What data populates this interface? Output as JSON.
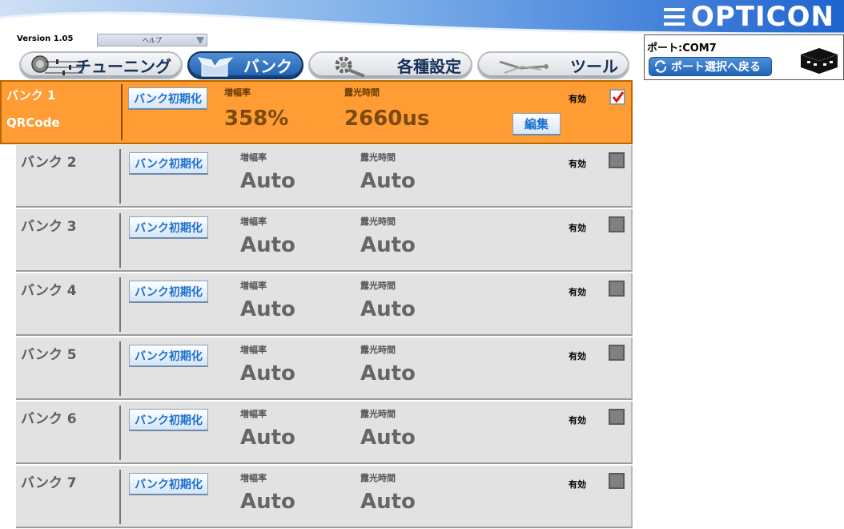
{
  "app": {
    "logo_text": "OPTICON",
    "version": "Version 1.05",
    "help_menu": "ヘルプ"
  },
  "tabs": [
    {
      "label": "チューニング",
      "icon": "tuning-sliders-icon",
      "active": false
    },
    {
      "label": "バンク",
      "icon": "bank-box-icon",
      "active": true
    },
    {
      "label": "各種設定",
      "icon": "settings-gear-icon",
      "active": false
    },
    {
      "label": "ツール",
      "icon": "tools-icon",
      "active": false
    }
  ],
  "port": {
    "label": "ポート:COM7",
    "back_button": "ポート選択へ戻る"
  },
  "labels": {
    "init_button": "バンク初期化",
    "gain": "増幅率",
    "exposure": "露光時間",
    "enable": "有効",
    "edit_button": "編集"
  },
  "banks": [
    {
      "name": "バンク 1",
      "code": "QRCode",
      "gain": "358%",
      "exposure": "2660us",
      "enabled": true
    },
    {
      "name": "バンク 2",
      "gain": "Auto",
      "exposure": "Auto",
      "enabled": false
    },
    {
      "name": "バンク 3",
      "gain": "Auto",
      "exposure": "Auto",
      "enabled": false
    },
    {
      "name": "バンク 4",
      "gain": "Auto",
      "exposure": "Auto",
      "enabled": false
    },
    {
      "name": "バンク 5",
      "gain": "Auto",
      "exposure": "Auto",
      "enabled": false
    },
    {
      "name": "バンク 6",
      "gain": "Auto",
      "exposure": "Auto",
      "enabled": false
    },
    {
      "name": "バンク 7",
      "gain": "Auto",
      "exposure": "Auto",
      "enabled": false
    }
  ],
  "colors": {
    "header_blue": "#2f6fd0",
    "active_bank": "#ff9c33",
    "inactive_bank": "#e2e2e2",
    "button_text": "#1a6fd0"
  }
}
